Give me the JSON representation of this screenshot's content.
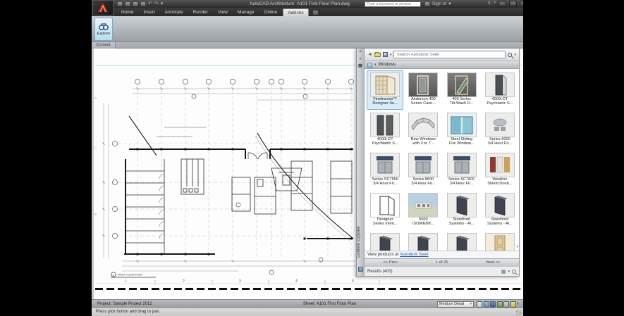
{
  "titlebar": {
    "app_title": "AutoCAD Architecture",
    "doc_title": "A101 First Floor Plan.dwg",
    "search_placeholder": "Type a keyword or phrase",
    "sign_in": "Sign In"
  },
  "icons": {
    "close": "×",
    "minimize": "—",
    "restore": "□",
    "help": "?",
    "exchange": "X",
    "dropdown": "▾",
    "back": "◄",
    "forward": "►",
    "undo": "↶",
    "redo": "↷",
    "grid_view": "▦",
    "pin": "»",
    "scroll_down": "▾"
  },
  "ribbon": {
    "tabs": [
      "Home",
      "Insert",
      "Annotate",
      "Render",
      "View",
      "Manage",
      "Online",
      "Add-Ins"
    ],
    "active_tab": "Add-Ins",
    "explore_label": "Explore",
    "panel_label": "Content"
  },
  "seek": {
    "vertical_tab": "Content Explorer",
    "search_placeholder": "Search Autodesk Seek",
    "category": "Windows",
    "products": [
      {
        "l1": "Fineframes™",
        "l2": "Designer Se..."
      },
      {
        "l1": "Andersen 400",
        "l2": "Series Case..."
      },
      {
        "l1": "400 Series",
        "l2": "Tilt-Wash D..."
      },
      {
        "l1": "4000i-DT",
        "l2": "Psychiatric S..."
      },
      {
        "l1": "4000i-DT",
        "l2": "Psychiatric S..."
      },
      {
        "l1": "Bow Windows",
        "l2": "with 3 to 7..."
      },
      {
        "l1": "Steel Sliding",
        "l2": "Fire Window..."
      },
      {
        "l1": "Series 6000",
        "l2": "3/4 Hour Fir..."
      },
      {
        "l1": "Series SC7650",
        "l2": "3/4 Hour Fir..."
      },
      {
        "l1": "Series 8600",
        "l2": "3/4 Hour Fir..."
      },
      {
        "l1": "Series SC7600",
        "l2": "3/4 Hour Fir..."
      },
      {
        "l1": "Weather",
        "l2": "Shield Doub..."
      },
      {
        "l1": "Designer",
        "l2": "Series Interi..."
      },
      {
        "l1": "5500",
        "l2": "ISOWEB®..."
      },
      {
        "l1": "Storefront",
        "l2": "Systems - Al..."
      },
      {
        "l1": "Storefront",
        "l2": "Systems - Al..."
      }
    ],
    "view_products_prefix": "View products at",
    "view_products_link": "Autodesk Seek",
    "pagination": {
      "prev": "<< Prev",
      "page": "1 of 25",
      "next": "Next >>"
    },
    "results": "Results (400)"
  },
  "drawing": {
    "sheet_title_number": "1",
    "sheet_title": "FIRST FLOOR PLAN",
    "ruler_numbers": [
      "1",
      "2",
      "3",
      "4",
      "5"
    ],
    "edge_letters": [
      "D",
      "C",
      "B"
    ]
  },
  "statusbar": {
    "project": "Project: Sample Project 2012",
    "sheet": "Sheet: A101 First Floor Plan",
    "detail_level": "Medium Detail",
    "prompt": "Press pick button and drag to pan."
  }
}
